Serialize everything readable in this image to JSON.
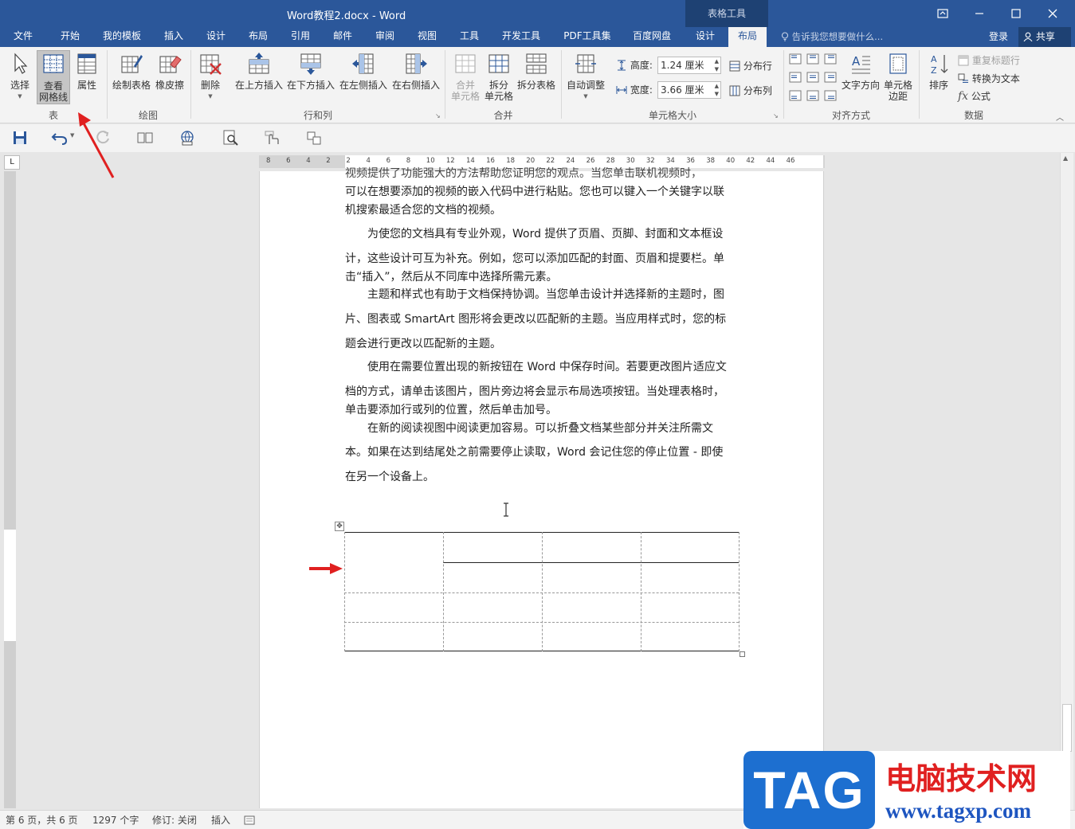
{
  "window": {
    "title": "Word教程2.docx - Word",
    "context_group": "表格工具",
    "controls": [
      "restore-ribbon",
      "minimize",
      "maximize",
      "close"
    ]
  },
  "menu": {
    "tabs": [
      "文件",
      "开始",
      "我的模板",
      "插入",
      "设计",
      "布局",
      "引用",
      "邮件",
      "审阅",
      "视图",
      "工具",
      "开发工具",
      "PDF工具集",
      "百度网盘",
      "设计",
      "布局"
    ],
    "active_index": 15,
    "tell_me": "告诉我您想要做什么...",
    "login": "登录",
    "share": "共享"
  },
  "ribbon": {
    "groups": {
      "table": "表",
      "draw": "绘图",
      "rows_cols": "行和列",
      "merge": "合并",
      "cell_size": "单元格大小",
      "align": "对齐方式",
      "data": "数据"
    },
    "buttons": {
      "select": "选择",
      "view_grid_1": "查看",
      "view_grid_2": "网格线",
      "properties": "属性",
      "draw_table": "绘制表格",
      "eraser": "橡皮擦",
      "delete": "删除",
      "insert_above": "在上方插入",
      "insert_below": "在下方插入",
      "insert_left": "在左侧插入",
      "insert_right": "在右侧插入",
      "merge_1": "合并",
      "merge_2": "单元格",
      "split_1": "拆分",
      "split_2": "单元格",
      "split_table": "拆分表格",
      "autofit": "自动调整",
      "height_label": "高度:",
      "height_value": "1.24 厘米",
      "width_label": "宽度:",
      "width_value": "3.66 厘米",
      "distribute_rows": "分布行",
      "distribute_cols": "分布列",
      "text_direction": "文字方向",
      "cell_margin_1": "单元格",
      "cell_margin_2": "边距",
      "sort": "排序",
      "repeat_header": "重复标题行",
      "convert_text": "转换为文本",
      "formula": "公式"
    }
  },
  "ruler": {
    "ticks": [
      "8",
      "6",
      "4",
      "2",
      "2",
      "4",
      "6",
      "8",
      "10",
      "12",
      "14",
      "16",
      "18",
      "20",
      "22",
      "24",
      "26",
      "28",
      "30",
      "32",
      "34",
      "36",
      "38",
      "40",
      "42",
      "44",
      "46"
    ]
  },
  "document": {
    "paragraphs": [
      "视频提供了功能强大的方法帮助您证明您的观点。当您单击联机视频时，",
      "可以在想要添加的视频的嵌入代码中进行粘贴。您也可以键入一个关键字以联",
      "机搜索最适合您的文档的视频。",
      "为使您的文档具有专业外观，Word 提供了页眉、页脚、封面和文本框设",
      "计，这些设计可互为补充。例如，您可以添加匹配的封面、页眉和提要栏。单",
      "击“插入”，然后从不同库中选择所需元素。",
      "主题和样式也有助于文档保持协调。当您单击设计并选择新的主题时，图",
      "片、图表或 SmartArt 图形将会更改以匹配新的主题。当应用样式时，您的标",
      "题会进行更改以匹配新的主题。",
      "使用在需要位置出现的新按钮在 Word 中保存时间。若要更改图片适应文",
      "档的方式，请单击该图片，图片旁边将会显示布局选项按钮。当处理表格时，",
      "单击要添加行或列的位置，然后单击加号。",
      "在新的阅读视图中阅读更加容易。可以折叠文档某些部分并关注所需文",
      "本。如果在达到结尾处之前需要停止读取，Word 会记住您的停止位置 - 即使",
      "在另一个设备上。"
    ]
  },
  "status": {
    "page": "第 6 页，共 6 页",
    "words": "1297 个字",
    "track": "修订: 关闭",
    "mode": "插入"
  },
  "watermark": {
    "logo": "TAG",
    "name": "电脑技术网",
    "url": "www.tagxp.com"
  },
  "colors": {
    "accent": "#2b579a",
    "annotation_arrow": "#e02020"
  }
}
